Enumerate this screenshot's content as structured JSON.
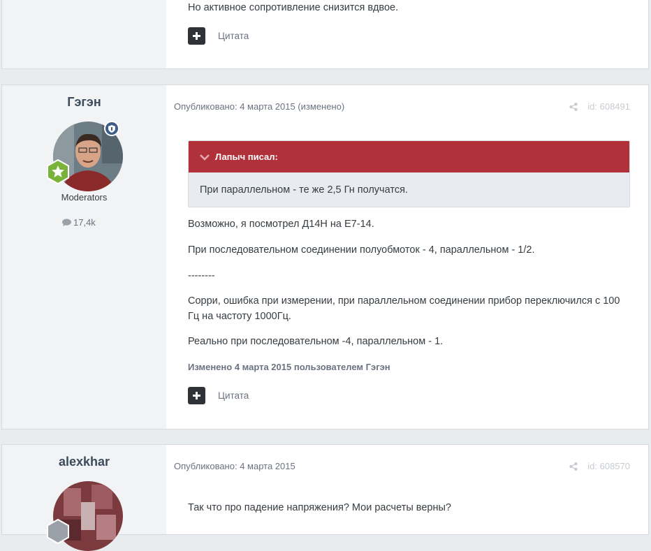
{
  "posts": [
    {
      "paragraphs": [
        "Но активное сопротивление снизится вдвое."
      ],
      "quote_label": "Цитата"
    },
    {
      "author": "Гэгэн",
      "group": "Moderators",
      "post_count": "17,4k",
      "published": "Опубликовано: 4 марта 2015 (изменено)",
      "post_id": "id: 608491",
      "quote": {
        "header": "Лапыч писал:",
        "text": "При параллельном - те же 2,5 Гн получатся."
      },
      "paragraphs": [
        "Возможно, я посмотрел Д14Н на Е7-14.",
        "При последовательном соединении полуобмоток - 4, параллельном - 1/2.",
        "--------",
        "Сорри, ошибка при измерении, при параллельном соединении прибор переключился с 100 Гц на частоту 1000Гц.",
        "Реально при последовательном -4, параллельном - 1."
      ],
      "edited_note": "Изменено 4 марта 2015 пользователем Гэгэн",
      "quote_label": "Цитата"
    },
    {
      "author": "alexkhar",
      "published": "Опубликовано: 4 марта 2015",
      "post_id": "id: 608570",
      "paragraphs": [
        "Так что про падение напряжения? Мои расчеты верны?"
      ]
    }
  ],
  "colors": {
    "quote_header": "#b0313a",
    "moderator_badge": "#3e5c88",
    "rank_badge": "#7ab33a"
  },
  "icons": [
    "plus-icon",
    "share-icon",
    "chevron-down-icon",
    "comment-icon",
    "shield-icon",
    "star-icon"
  ]
}
